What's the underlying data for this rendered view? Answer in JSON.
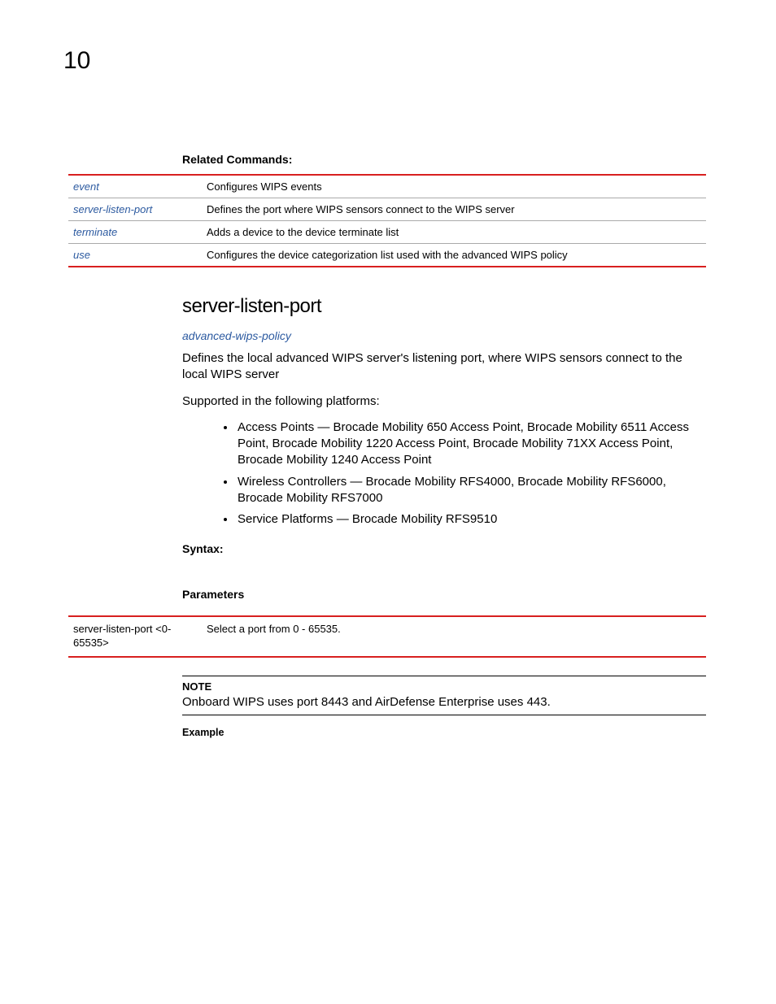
{
  "page_number": "10",
  "related_commands": {
    "heading": "Related Commands:",
    "rows": [
      {
        "cmd": "event",
        "desc": "Configures WIPS events"
      },
      {
        "cmd": "server-listen-port",
        "desc": "Defines the port where WIPS sensors connect to the WIPS server"
      },
      {
        "cmd": "terminate",
        "desc": "Adds a device to the device terminate list"
      },
      {
        "cmd": "use",
        "desc": "Configures the device categorization list used with the advanced WIPS policy"
      }
    ]
  },
  "section": {
    "title": "server-listen-port",
    "crossref": "advanced-wips-policy",
    "description": "Defines the local advanced WIPS server's listening port, where WIPS sensors connect to the local WIPS server",
    "supported_label": "Supported in the following platforms:",
    "platforms": [
      "Access Points — Brocade Mobility 650 Access Point, Brocade Mobility 6511 Access Point, Brocade Mobility 1220 Access Point, Brocade Mobility 71XX Access Point, Brocade Mobility 1240 Access Point",
      "Wireless Controllers — Brocade Mobility RFS4000, Brocade Mobility RFS6000, Brocade Mobility RFS7000",
      "Service Platforms — Brocade Mobility RFS9510"
    ],
    "syntax_label": "Syntax:",
    "parameters_label": "Parameters",
    "parameters": [
      {
        "param": "server-listen-port <0-65535>",
        "desc": "Select a port from 0 - 65535."
      }
    ],
    "note_title": "NOTE",
    "note_body": "Onboard WIPS uses port 8443 and AirDefense Enterprise uses 443.",
    "example_label": "Example"
  }
}
